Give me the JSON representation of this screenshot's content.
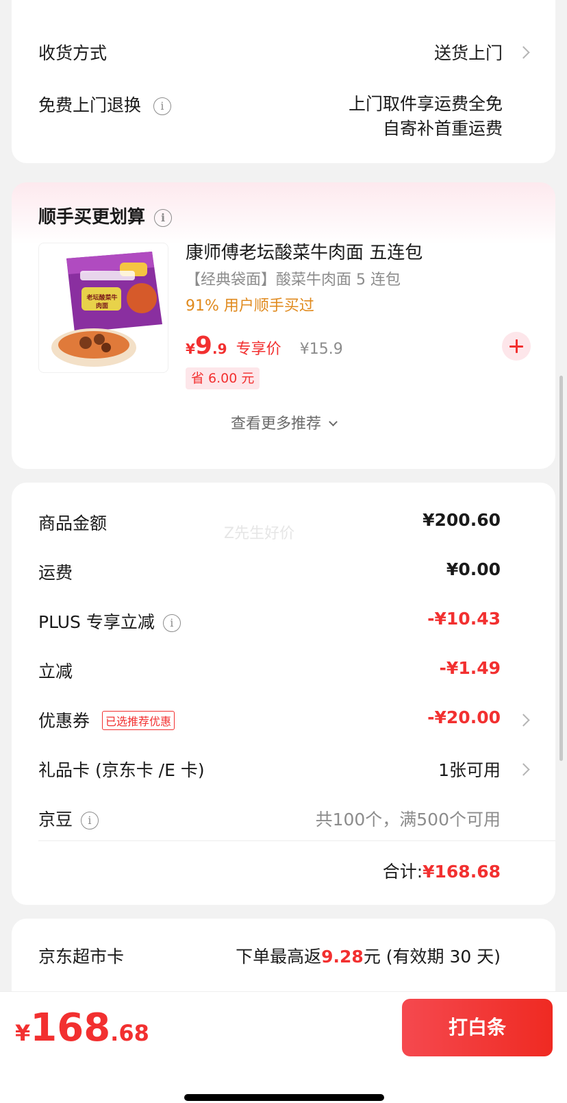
{
  "delivery": {
    "method_label": "收货方式",
    "method_value": "送货上门",
    "return_label": "免费上门退换",
    "return_line1": "上门取件享运费全免",
    "return_line2": "自寄补首重运费"
  },
  "addon": {
    "title": "顺手买更划算",
    "product_name": "康师傅老坛酸菜牛肉面 五连包",
    "product_subtitle": "【经典袋面】酸菜牛肉面 5 连包",
    "buy_stat": "91% 用户顺手买过",
    "price_symbol": "¥",
    "price_int": "9",
    "price_dec": ".9",
    "price_tag": "专享价",
    "orig_price": "¥15.9",
    "save_text": "省 6.00 元",
    "more_label": "查看更多推荐",
    "image_text": "老坛酸菜牛肉面"
  },
  "summary": {
    "goods_label": "商品金额",
    "goods_value": "¥200.60",
    "watermark": "Z先生好价",
    "shipping_label": "运费",
    "shipping_value": "¥0.00",
    "plus_label": "PLUS 专享立减",
    "plus_value": "-¥10.43",
    "direct_label": "立减",
    "direct_value": "-¥1.49",
    "coupon_label": "优惠券",
    "coupon_badge": "已选推荐优惠",
    "coupon_value": "-¥20.00",
    "giftcard_label": "礼品卡 (京东卡 /E 卡)",
    "giftcard_value": "1张可用",
    "beans_label": "京豆",
    "beans_value": "共100个，满500个可用",
    "total_label": "合计:",
    "total_value": "¥168.68"
  },
  "market_card": {
    "label": "京东超市卡",
    "prefix": "下单最高返",
    "amount": "9.28",
    "suffix": "元 (有效期 30 天)"
  },
  "footer": {
    "symbol": "¥",
    "int": "168",
    "dec": ".68",
    "pay_button": "打白条"
  },
  "colors": {
    "accent": "#f23030",
    "orange": "#e08a1e",
    "pink_bg": "#fde6ea"
  }
}
